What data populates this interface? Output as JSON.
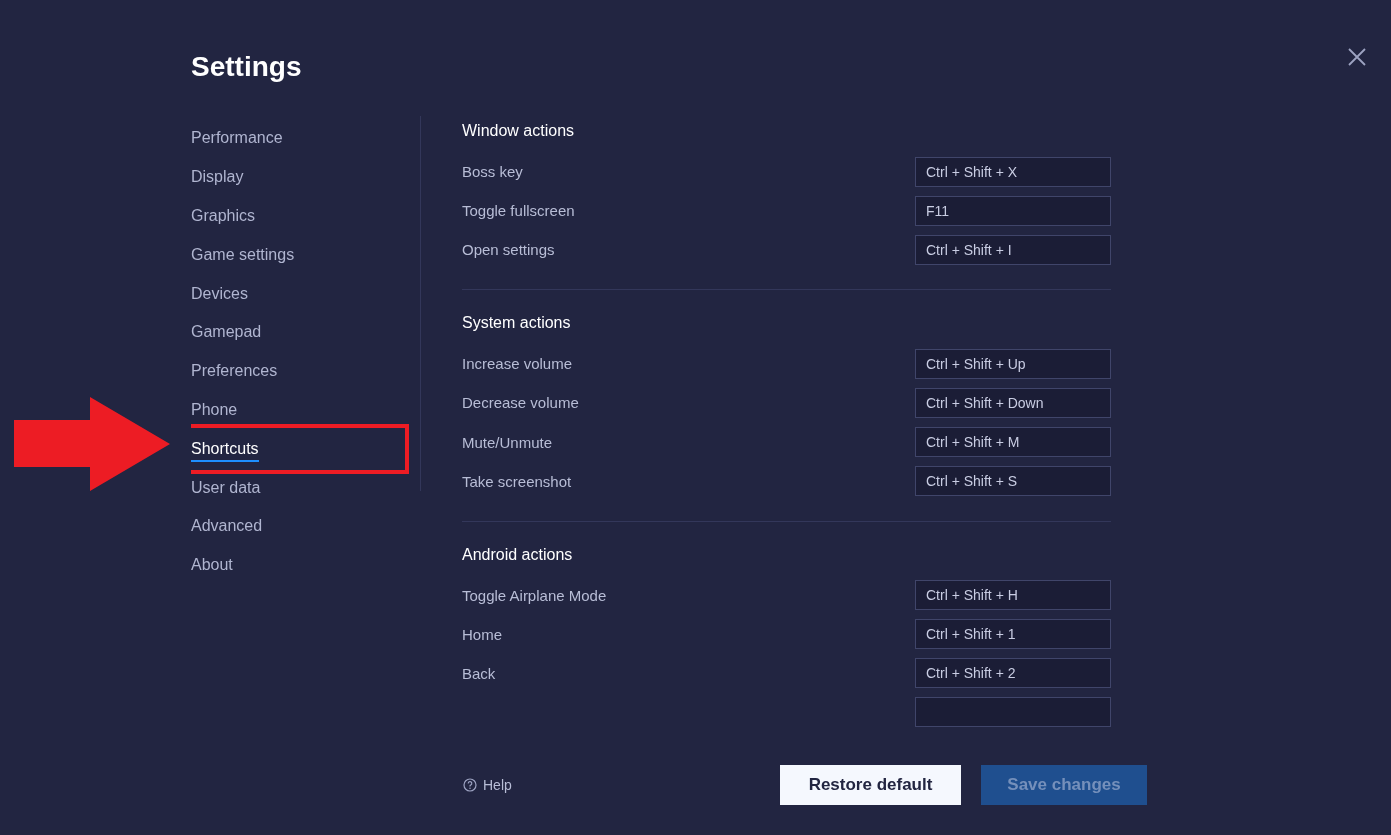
{
  "window": {
    "title": "Settings"
  },
  "sidebar": {
    "items": [
      {
        "label": "Performance",
        "selected": false
      },
      {
        "label": "Display",
        "selected": false
      },
      {
        "label": "Graphics",
        "selected": false
      },
      {
        "label": "Game settings",
        "selected": false
      },
      {
        "label": "Devices",
        "selected": false
      },
      {
        "label": "Gamepad",
        "selected": false
      },
      {
        "label": "Preferences",
        "selected": false
      },
      {
        "label": "Phone",
        "selected": false
      },
      {
        "label": "Shortcuts",
        "selected": true
      },
      {
        "label": "User data",
        "selected": false
      },
      {
        "label": "Advanced",
        "selected": false
      },
      {
        "label": "About",
        "selected": false
      }
    ]
  },
  "sections": [
    {
      "title": "Window actions",
      "rows": [
        {
          "label": "Boss key",
          "shortcut": "Ctrl + Shift + X"
        },
        {
          "label": "Toggle fullscreen",
          "shortcut": "F11"
        },
        {
          "label": "Open settings",
          "shortcut": "Ctrl + Shift + I"
        }
      ]
    },
    {
      "title": "System actions",
      "rows": [
        {
          "label": "Increase volume",
          "shortcut": "Ctrl + Shift + Up"
        },
        {
          "label": "Decrease volume",
          "shortcut": "Ctrl + Shift + Down"
        },
        {
          "label": "Mute/Unmute",
          "shortcut": "Ctrl + Shift + M"
        },
        {
          "label": "Take screenshot",
          "shortcut": "Ctrl + Shift + S"
        }
      ]
    },
    {
      "title": "Android actions",
      "rows": [
        {
          "label": "Toggle Airplane Mode",
          "shortcut": "Ctrl + Shift + H"
        },
        {
          "label": "Home",
          "shortcut": "Ctrl + Shift + 1"
        },
        {
          "label": "Back",
          "shortcut": "Ctrl + Shift + 2"
        }
      ]
    }
  ],
  "footer": {
    "help": "Help",
    "buttons": [
      {
        "label": "Restore default",
        "kind": "secondary",
        "disabled": false
      },
      {
        "label": "Save changes",
        "kind": "primary",
        "disabled": true
      }
    ]
  }
}
